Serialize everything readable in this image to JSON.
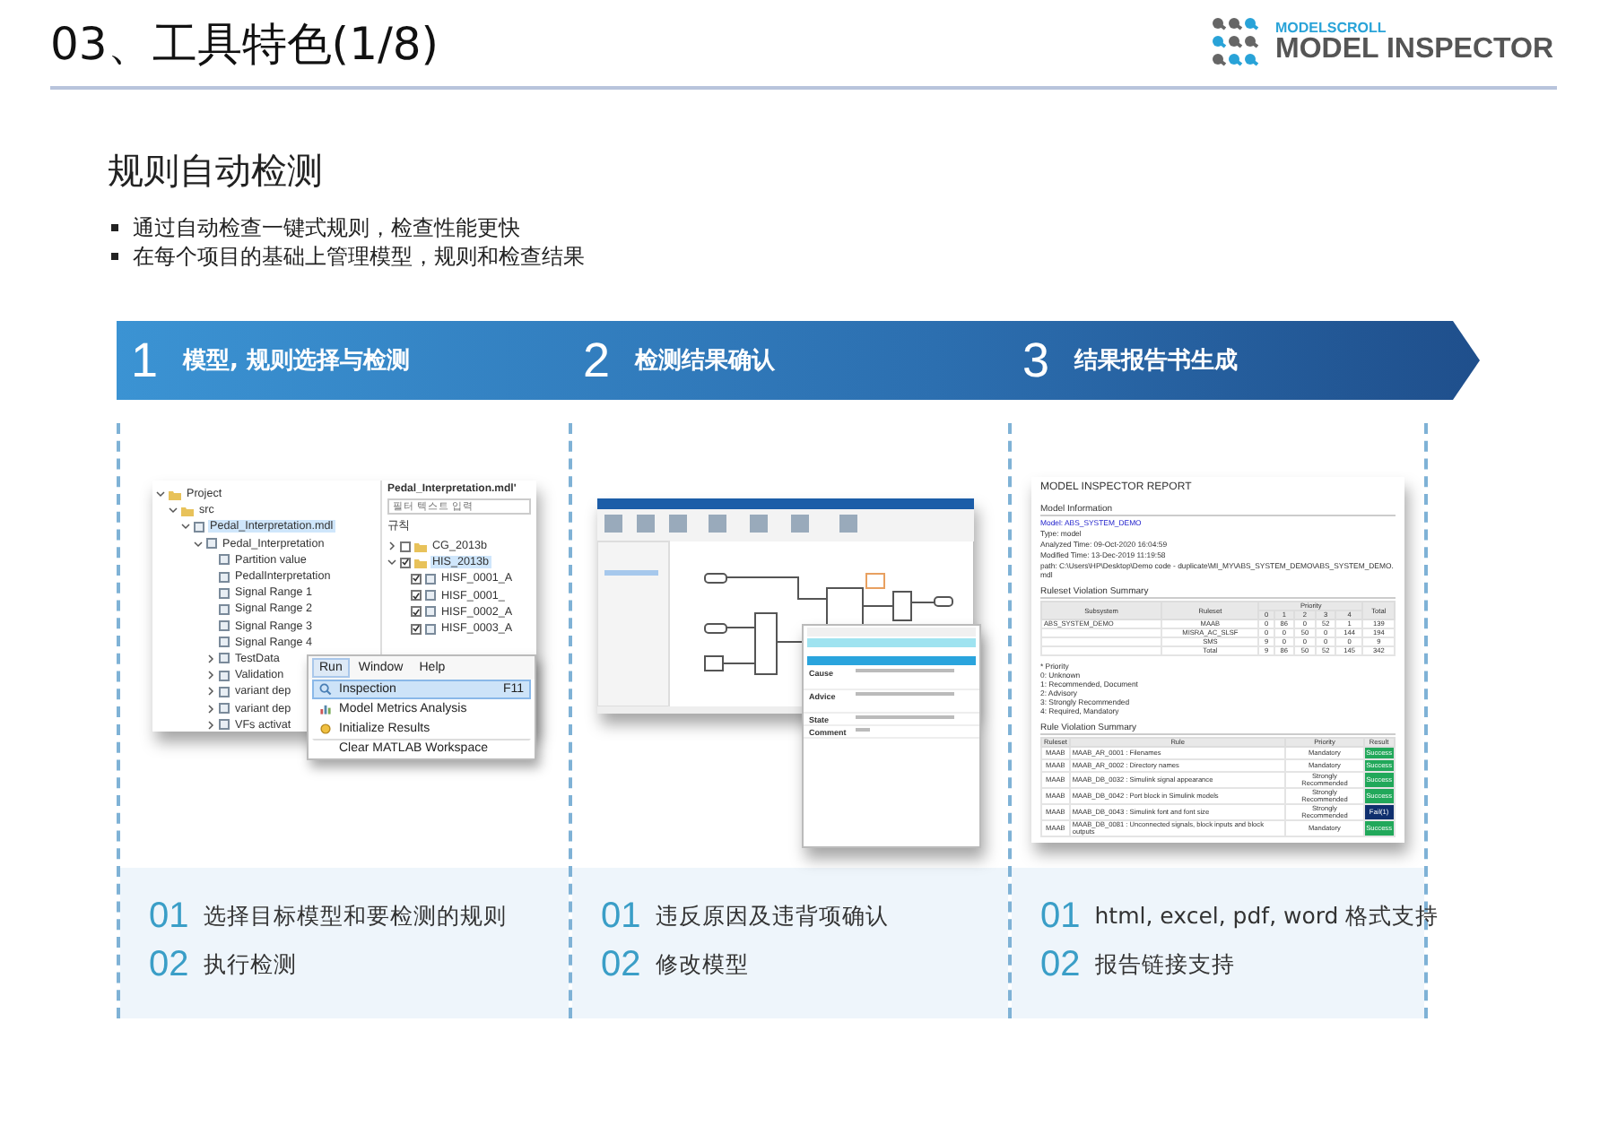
{
  "header": {
    "title": "03、工具特色(1/8)",
    "logo": {
      "brand": "MODELSCROLL",
      "product": "MODEL INSPECTOR"
    }
  },
  "section": {
    "heading": "规则自动检测",
    "bullets": [
      "通过自动检查一键式规则，检查性能更快",
      "在每个项目的基础上管理模型，规则和检查结果"
    ]
  },
  "steps": [
    {
      "number": "1",
      "label": "模型, 规则选择与检测"
    },
    {
      "number": "2",
      "label": "检测结果确认"
    },
    {
      "number": "3",
      "label": "结果报告书生成"
    }
  ],
  "panels": [
    {
      "kind": "tool",
      "screenshot": {
        "tree": [
          {
            "label": "Project",
            "kind": "folder",
            "expanded": true,
            "selected": false,
            "children": [
              {
                "label": "src",
                "kind": "folder",
                "expanded": true,
                "selected": false,
                "children": [
                  {
                    "label": "Pedal_Interpretation.mdl",
                    "kind": "model",
                    "expanded": true,
                    "selected": true,
                    "children": [
                      {
                        "label": "Pedal_Interpretation",
                        "kind": "model",
                        "expanded": true,
                        "selected": false,
                        "children": [
                          {
                            "label": "Partition value",
                            "kind": "model",
                            "selected": false
                          },
                          {
                            "label": "PedalInterpretation",
                            "kind": "model",
                            "selected": false
                          },
                          {
                            "label": "Signal Range 1",
                            "kind": "model",
                            "selected": false
                          },
                          {
                            "label": "Signal Range 2",
                            "kind": "model",
                            "selected": false
                          },
                          {
                            "label": "Signal Range 3",
                            "kind": "model",
                            "selected": false
                          },
                          {
                            "label": "Signal Range 4",
                            "kind": "model",
                            "selected": false
                          },
                          {
                            "label": "TestData",
                            "kind": "model",
                            "expanded": false,
                            "selected": false
                          },
                          {
                            "label": "Validation",
                            "kind": "model",
                            "expanded": false,
                            "selected": false
                          },
                          {
                            "label": "variant dep",
                            "kind": "model",
                            "expanded": false,
                            "selected": false
                          },
                          {
                            "label": "variant dep",
                            "kind": "model",
                            "expanded": false,
                            "selected": false
                          },
                          {
                            "label": "VFs activat",
                            "kind": "model",
                            "expanded": false,
                            "selected": false
                          }
                        ]
                      }
                    ]
                  }
                ]
              }
            ]
          }
        ],
        "rules_title": "Pedal_Interpretation.mdl'",
        "rules_search": {
          "placeholder": "필터 텍스트 입력"
        },
        "rules_label": "규칙",
        "rules": [
          {
            "label": "CG_2013b",
            "checked": false,
            "expanded": false,
            "selected": false
          },
          {
            "label": "HIS_2013b",
            "checked": true,
            "expanded": true,
            "selected": true,
            "children": [
              {
                "label": "HISF_0001_A",
                "checked": true,
                "selected": false
              },
              {
                "label": "HISF_0001_",
                "checked": true,
                "selected": false
              },
              {
                "label": "HISF_0002_A",
                "checked": true,
                "selected": false
              },
              {
                "label": "HISF_0003_A",
                "checked": true,
                "selected": false
              }
            ]
          }
        ],
        "menubar": [
          {
            "label": "Run",
            "selected": true
          },
          {
            "label": "Window",
            "selected": false
          },
          {
            "label": "Help",
            "selected": false
          }
        ],
        "menu": [
          {
            "label": "Inspection",
            "shortcut": "F11",
            "kind": "search",
            "selected": true
          },
          {
            "label": "Model Metrics Analysis",
            "kind": "metrics",
            "selected": false
          },
          {
            "label": "Initialize Results",
            "kind": "reset",
            "selected": false
          },
          {
            "label": "Clear MATLAB Workspace",
            "kind": "plain",
            "selected": false
          }
        ]
      },
      "items": [
        {
          "number": "01",
          "text": "选择目标模型和要检测的规则"
        },
        {
          "number": "02",
          "text": "执行检测"
        }
      ]
    },
    {
      "kind": "model",
      "screenshot": {
        "dialog_labels": [
          "Cause",
          "Advice",
          "State",
          "Comment"
        ]
      },
      "items": [
        {
          "number": "01",
          "text": "违反原因及违背项确认"
        },
        {
          "number": "02",
          "text": "修改模型"
        }
      ]
    },
    {
      "kind": "report",
      "screenshot": {
        "title": "MODEL INSPECTOR REPORT",
        "info_heading": "Model Information",
        "info_lines": [
          "Model: ABS_SYSTEM_DEMO",
          "Type: model",
          "Analyzed Time: 09-Oct-2020 16:04:59",
          "Modified Time: 13-Dec-2019 11:19:58",
          "path: C:\\Users\\HP\\Desktop\\Demo code - duplicate\\MI_MY\\ABS_SYSTEM_DEMO\\ABS_SYSTEM_DEMO.mdl"
        ],
        "summary_heading": "Ruleset Violation Summary",
        "summary_columns": [
          "Subsystem",
          "Ruleset",
          "Priority",
          "Total"
        ],
        "priority_levels": [
          "0",
          "1",
          "2",
          "3",
          "4"
        ],
        "summary_rows": [
          {
            "subsystem": "ABS_SYSTEM_DEMO",
            "cells": [
              "MAAB",
              "0",
              "86",
              "0",
              "52",
              "1",
              "139"
            ]
          },
          {
            "subsystem": "",
            "cells": [
              "MISRA_AC_SLSF",
              "0",
              "0",
              "50",
              "0",
              "144",
              "194"
            ]
          },
          {
            "subsystem": "",
            "cells": [
              "SMS",
              "9",
              "0",
              "0",
              "0",
              "0",
              "9"
            ]
          },
          {
            "subsystem": "",
            "cells": [
              "Total",
              "9",
              "86",
              "50",
              "52",
              "145",
              "342"
            ]
          }
        ],
        "legend": [
          "* Priority",
          "0: Unknown",
          "1: Recommended, Document",
          "2: Advisory",
          "3: Strongly Recommended",
          "4: Required, Mandatory"
        ],
        "rule_heading": "Rule Violation Summary",
        "rule_columns": [
          "Ruleset",
          "Rule",
          "Priority",
          "Result"
        ],
        "rule_rows": [
          {
            "ruleset": "MAAB",
            "rule": "MAAB_AR_0001 : Filenames",
            "priority": "Mandatory",
            "result": "Success",
            "color": "#21a85a"
          },
          {
            "ruleset": "MAAB",
            "rule": "MAAB_AR_0002 : Directory names",
            "priority": "Mandatory",
            "result": "Success",
            "color": "#21a85a"
          },
          {
            "ruleset": "MAAB",
            "rule": "MAAB_DB_0032 : Simulink signal appearance",
            "priority": "Strongly Recommended",
            "result": "Success",
            "color": "#21a85a"
          },
          {
            "ruleset": "MAAB",
            "rule": "MAAB_DB_0042 : Port block in Simulink models",
            "priority": "Strongly Recommended",
            "result": "Success",
            "color": "#21a85a"
          },
          {
            "ruleset": "MAAB",
            "rule": "MAAB_DB_0043 : Simulink font and font size",
            "priority": "Strongly Recommended",
            "result": "Fail(1)",
            "color": "#0f2f6e"
          },
          {
            "ruleset": "MAAB",
            "rule": "MAAB_DB_0081 : Unconnected signals, block inputs and block outputs",
            "priority": "Mandatory",
            "result": "Success",
            "color": "#21a85a"
          }
        ]
      },
      "items": [
        {
          "number": "01",
          "text": "html, excel, pdf, word 格式支持"
        },
        {
          "number": "02",
          "text": "报告链接支持"
        }
      ]
    }
  ]
}
